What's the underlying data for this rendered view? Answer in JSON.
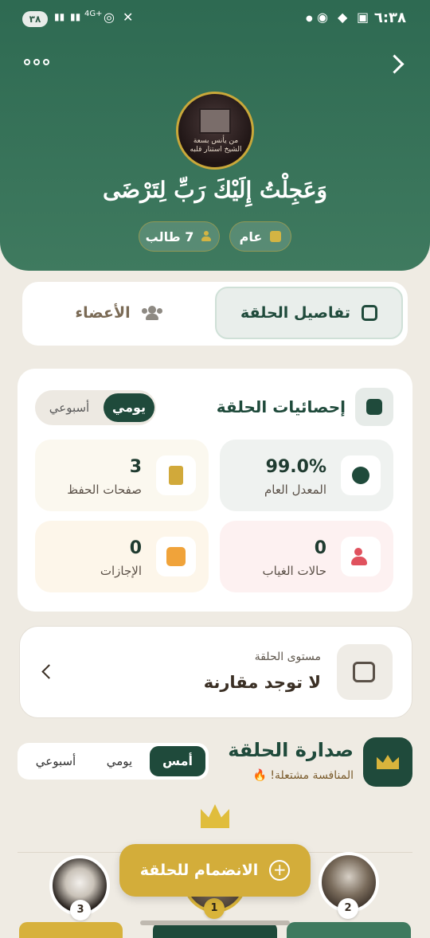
{
  "status_bar": {
    "battery": "٣٨",
    "time": "٦:٣٨",
    "network": "4G+"
  },
  "header": {
    "group_title": "وَعَجِلْتُ إِلَيْكَ رَبِّ لِتَرْضَى",
    "avatar_caption": "من يأنس بسعة الشيخ استنار قلبه",
    "pill_visibility": "عام",
    "pill_students": "7 طالب"
  },
  "tabs": {
    "details": "تفاصيل الحلقة",
    "members": "الأعضاء"
  },
  "stats": {
    "title": "إحصائيات الحلقة",
    "toggle_daily": "يومي",
    "toggle_weekly": "أسبوعي",
    "items": [
      {
        "value": "99.0%",
        "label": "المعدل العام"
      },
      {
        "value": "3",
        "label": "صفحات الحفظ"
      },
      {
        "value": "0",
        "label": "حالات الغياب"
      },
      {
        "value": "0",
        "label": "الإجازات"
      }
    ]
  },
  "level": {
    "subtitle": "مستوى الحلقة",
    "value": "لا توجد مقارنة"
  },
  "leaderboard": {
    "title": "صدارة الحلقة",
    "subtitle": "المنافسة مشتعلة!",
    "flame": "🔥",
    "tabs": [
      "أمس",
      "يومي",
      "أسبوعي"
    ],
    "ranks": [
      "1",
      "2",
      "3"
    ]
  },
  "join_button": "الانضمام للحلقة",
  "colors": {
    "primary": "#1f4a3b",
    "header": "#3f7a5f",
    "gold": "#d3ad3a"
  }
}
